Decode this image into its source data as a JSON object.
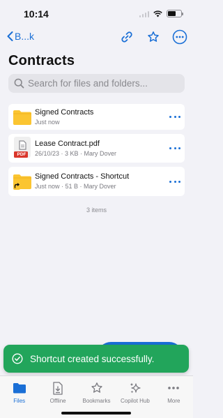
{
  "status_bar": {
    "time": "10:14",
    "icons": [
      "cellular-signal-icon",
      "wifi-icon",
      "battery-icon"
    ],
    "battery_level": 0.6
  },
  "nav": {
    "back_label": "B...k",
    "actions": [
      "link-icon",
      "star-icon",
      "more-circle-icon"
    ]
  },
  "page": {
    "title": "Contracts"
  },
  "search": {
    "placeholder": "Search for files and folders..."
  },
  "files": [
    {
      "name": "Signed Contracts",
      "meta": "Just now",
      "type": "folder"
    },
    {
      "name": "Lease Contract.pdf",
      "meta": "26/10/23 · 3 KB · Mary Dover",
      "type": "pdf",
      "badge": "PDF"
    },
    {
      "name": "Signed Contracts - Shortcut",
      "meta": "Just now · 51 B · Mary Dover",
      "type": "folder-shortcut"
    }
  ],
  "items_count": "3 items",
  "toast": {
    "message": "Shortcut created successfully.",
    "icon": "check-circle-icon"
  },
  "tabs": [
    {
      "label": "Files",
      "icon": "folder-icon",
      "active": true
    },
    {
      "label": "Offline",
      "icon": "offline-file-icon",
      "active": false
    },
    {
      "label": "Bookmarks",
      "icon": "star-icon",
      "active": false
    },
    {
      "label": "Copilot Hub",
      "icon": "sparkle-icon",
      "active": false
    },
    {
      "label": "More",
      "icon": "more-icon",
      "active": false
    }
  ],
  "colors": {
    "accent": "#1a6fd6",
    "toast_bg": "#22a55b",
    "folder": "#fbc531",
    "pdf_badge": "#d9362b",
    "background": "#f2f2f7"
  }
}
